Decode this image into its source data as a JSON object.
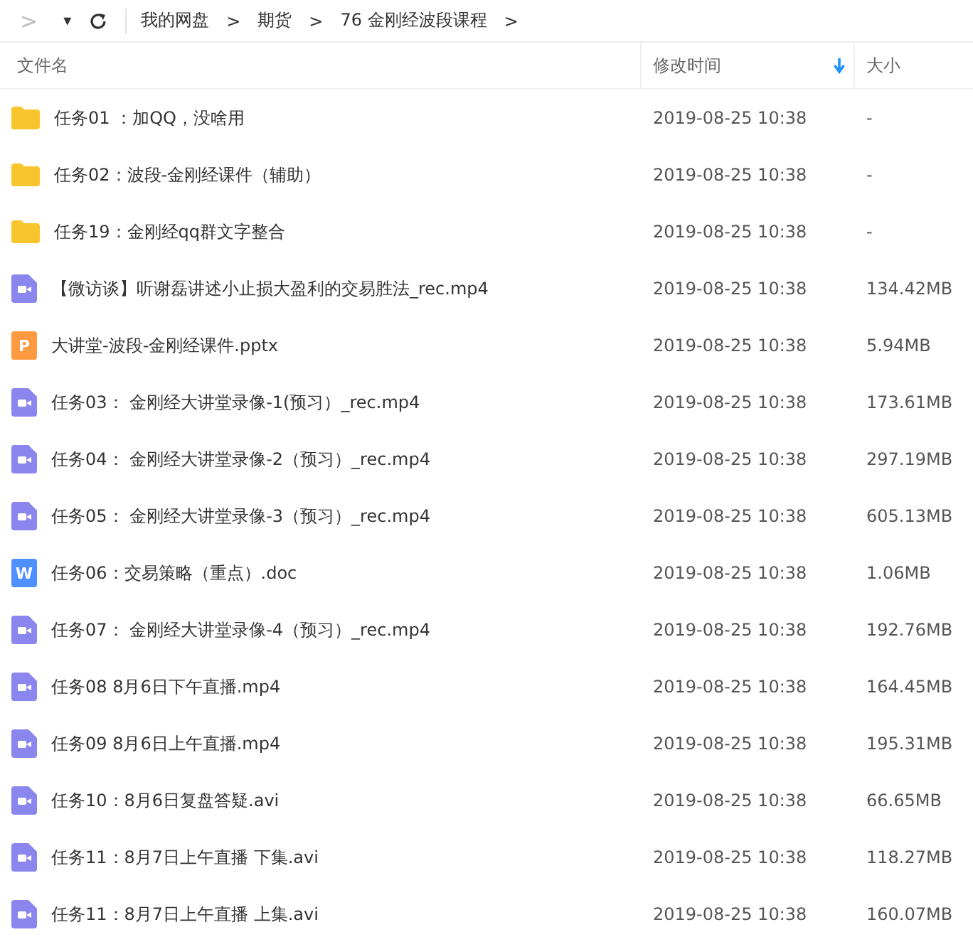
{
  "toolbar": {
    "forward": ">",
    "dropdown": "▾",
    "breadcrumbs": [
      {
        "label": "我的网盘",
        "sep": ">"
      },
      {
        "label": "期货",
        "sep": ">"
      },
      {
        "label": "76 金刚经波段课程",
        "sep": ">"
      }
    ]
  },
  "table": {
    "columns": [
      {
        "label": "文件名",
        "sorted": false
      },
      {
        "label": "修改时间",
        "sorted": true
      },
      {
        "label": "大小",
        "sorted": false
      }
    ],
    "rows": [
      {
        "kind": "folder",
        "name": "任务01 ：加QQ，没啥用",
        "time": "2019-08-25 10:38",
        "size": "-"
      },
      {
        "kind": "folder",
        "name": "任务02：波段-金刚经课件（辅助）",
        "time": "2019-08-25 10:38",
        "size": "-"
      },
      {
        "kind": "folder",
        "name": "任务19：金刚经qq群文字整合",
        "time": "2019-08-25 10:38",
        "size": "-"
      },
      {
        "kind": "video",
        "name": "【微访谈】听谢磊讲述小止损大盈利的交易胜法_rec.mp4",
        "time": "2019-08-25 10:38",
        "size": "134.42MB"
      },
      {
        "kind": "ppt",
        "badge": "P",
        "name": "大讲堂-波段-金刚经课件.pptx",
        "time": "2019-08-25 10:38",
        "size": "5.94MB"
      },
      {
        "kind": "video",
        "name": "任务03： 金刚经大讲堂录像-1(预习）_rec.mp4",
        "time": "2019-08-25 10:38",
        "size": "173.61MB"
      },
      {
        "kind": "video",
        "name": "任务04： 金刚经大讲堂录像-2（预习）_rec.mp4",
        "time": "2019-08-25 10:38",
        "size": "297.19MB"
      },
      {
        "kind": "video",
        "name": "任务05： 金刚经大讲堂录像-3（预习）_rec.mp4",
        "time": "2019-08-25 10:38",
        "size": "605.13MB"
      },
      {
        "kind": "doc",
        "badge": "W",
        "name": "任务06：交易策略（重点）.doc",
        "time": "2019-08-25 10:38",
        "size": "1.06MB"
      },
      {
        "kind": "video",
        "name": "任务07： 金刚经大讲堂录像-4（预习）_rec.mp4",
        "time": "2019-08-25 10:38",
        "size": "192.76MB"
      },
      {
        "kind": "video",
        "name": "任务08 8月6日下午直播.mp4",
        "time": "2019-08-25 10:38",
        "size": "164.45MB"
      },
      {
        "kind": "video",
        "name": "任务09 8月6日上午直播.mp4",
        "time": "2019-08-25 10:38",
        "size": "195.31MB"
      },
      {
        "kind": "video",
        "name": "任务10：8月6日复盘答疑.avi",
        "time": "2019-08-25 10:38",
        "size": "66.65MB"
      },
      {
        "kind": "video",
        "name": "任务11：8月7日上午直播  下集.avi",
        "time": "2019-08-25 10:38",
        "size": "118.27MB"
      },
      {
        "kind": "video",
        "name": "任务11：8月7日上午直播 上集.avi",
        "time": "2019-08-25 10:38",
        "size": "160.07MB"
      }
    ]
  }
}
